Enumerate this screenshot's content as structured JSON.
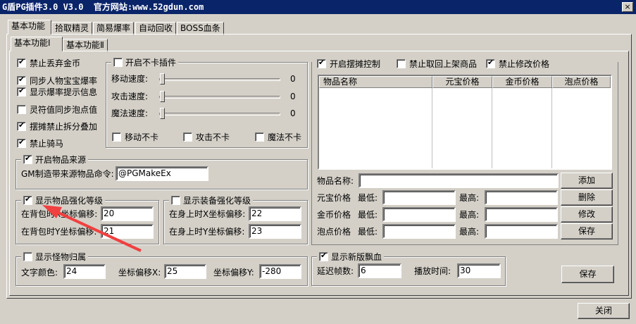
{
  "window": {
    "title": "G盾PG插件3.0 V3.0  官方网站:www.52gdun.com",
    "close_glyph": "×"
  },
  "tabs": [
    "基本功能",
    "拾取精灵",
    "简易爆率",
    "自动回收",
    "BOSS血条"
  ],
  "subtabs": [
    "基本功能Ⅰ",
    "基本功能Ⅱ"
  ],
  "left_checks": [
    {
      "label": "禁止丢弃金币",
      "checked": true
    },
    {
      "label": "同步人物宝宝爆率",
      "checked": true
    },
    {
      "label": "显示爆率提示信息",
      "checked": true
    },
    {
      "label": "灵符值同步泡点值",
      "checked": false
    },
    {
      "label": "摆摊禁止拆分叠加",
      "checked": true
    },
    {
      "label": "禁止骑马",
      "checked": true
    }
  ],
  "nolag": {
    "title": "开启不卡插件",
    "checked": false,
    "sliders": [
      {
        "label": "移动速度:",
        "value": 0
      },
      {
        "label": "攻击速度:",
        "value": 0
      },
      {
        "label": "魔法速度:",
        "value": 0
      }
    ],
    "checks": [
      {
        "label": "移动不卡",
        "checked": false
      },
      {
        "label": "攻击不卡",
        "checked": false
      },
      {
        "label": "魔法不卡",
        "checked": false
      }
    ]
  },
  "source": {
    "title": "开启物品来源",
    "checked": true,
    "label": "GM制造带来源物品命令:",
    "value": "@PGMakeEx"
  },
  "item_level": {
    "title": "显示物品强化等级",
    "checked": true,
    "x_label": "在背包时X坐标偏移:",
    "x": "20",
    "y_label": "在背包时Y坐标偏移:",
    "y": "21"
  },
  "equip_level": {
    "title": "显示装备强化等级",
    "checked": false,
    "x_label": "在身上时X坐标偏移:",
    "x": "22",
    "y_label": "在身上时Y坐标偏移:",
    "y": "23"
  },
  "monster": {
    "title": "显示怪物归属",
    "checked": false,
    "color_label": "文字颜色:",
    "color": "24",
    "x_label": "坐标偏移X:",
    "x": "25",
    "y_label": "坐标偏移Y:",
    "y": "-280"
  },
  "stall": {
    "checks": [
      {
        "label": "开启摆摊控制",
        "checked": true
      },
      {
        "label": "禁止取回上架商品",
        "checked": false
      },
      {
        "label": "禁止修改价格",
        "checked": true
      }
    ],
    "columns": [
      "物品名称",
      "元宝价格",
      "金币价格",
      "泡点价格"
    ],
    "name_label": "物品名称:",
    "min_label": "最低:",
    "max_label": "最高:",
    "price_rows": [
      "元宝价格",
      "金币价格",
      "泡点价格"
    ],
    "buttons": [
      "添加",
      "删除",
      "修改",
      "保存"
    ]
  },
  "blood": {
    "title": "显示新版飘血",
    "checked": true,
    "delay_label": "延迟帧数:",
    "delay": "6",
    "play_label": "播放时间:",
    "play": "30"
  },
  "save_label": "保存",
  "close_label": "关闭"
}
